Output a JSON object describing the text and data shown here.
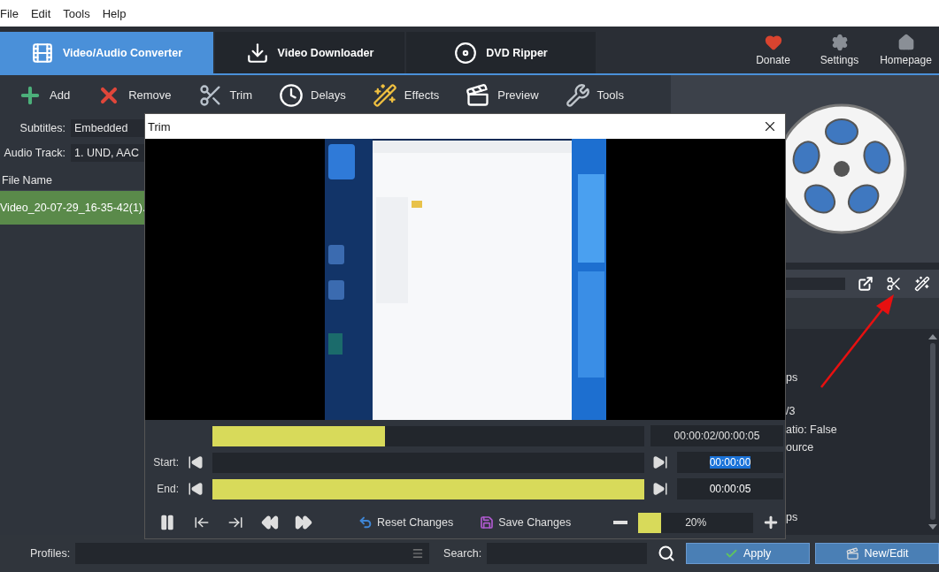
{
  "menu": [
    "File",
    "Edit",
    "Tools",
    "Help"
  ],
  "tabs": [
    {
      "label": "Video/Audio Converter",
      "selected": true
    },
    {
      "label": "Video Downloader",
      "selected": false
    },
    {
      "label": "DVD Ripper",
      "selected": false
    }
  ],
  "header_actions": [
    "Donate",
    "Settings",
    "Homepage"
  ],
  "toolbar": [
    "Add",
    "Remove",
    "Trim",
    "Delays",
    "Effects",
    "Preview",
    "Tools"
  ],
  "subtitles": {
    "label": "Subtitles:",
    "value": "Embedded"
  },
  "audio_track": {
    "label": "Audio Track:",
    "value": "1. UND, AAC"
  },
  "file_list": {
    "column": "File Name",
    "rows": [
      {
        "name": "Video_20-07-29_16-35-42(1).",
        "selected": true
      }
    ]
  },
  "info_lines": [
    "ps",
    "/3",
    "atio: False",
    "ource",
    "ps"
  ],
  "trim_dialog": {
    "title": "Trim",
    "position": {
      "level": 0.4
    },
    "time": "00:00:02/00:00:05",
    "start": {
      "label": "Start:",
      "level": 0,
      "value": "00:00:00",
      "selected": true
    },
    "end": {
      "label": "End:",
      "level": 1,
      "value": "00:00:05",
      "selected": false
    },
    "actions": [
      "Reset Changes",
      "Save Changes"
    ],
    "zoom": {
      "level": 0.2,
      "value": "20%"
    }
  },
  "profiles": {
    "label": "Profiles:"
  },
  "search": {
    "label": "Search:"
  },
  "buttons": [
    "Apply",
    "New/Edit"
  ]
}
